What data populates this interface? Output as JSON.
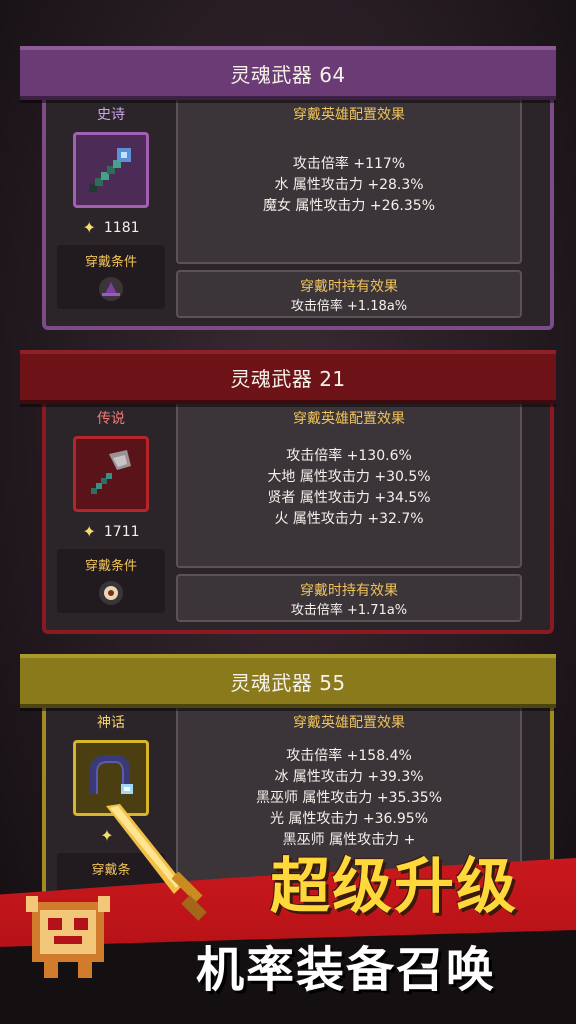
{
  "cards": [
    {
      "title": "灵魂武器 64",
      "rarity": "史诗",
      "power": "1181",
      "requirement_label": "穿戴条件",
      "requirement_icon": "wizard-hat-icon",
      "equip_effects_title": "穿戴英雄配置效果",
      "effects": [
        "攻击倍率 +117%",
        "水 属性攻击力 +28.3%",
        "魔女 属性攻击力 +26.35%"
      ],
      "hold_effects_title": "穿戴时持有效果",
      "hold_effect": "攻击倍率 +1.18a%",
      "weapon_icon": "magic-staff-icon",
      "colors": {
        "header": "#6a3b74",
        "border": "#7e4a88",
        "slot": "#a35fb3",
        "rarity": "#c9a6e8"
      }
    },
    {
      "title": "灵魂武器 21",
      "rarity": "传说",
      "power": "1711",
      "requirement_label": "穿戴条件",
      "requirement_icon": "eye-ring-icon",
      "equip_effects_title": "穿戴英雄配置效果",
      "effects": [
        "攻击倍率 +130.6%",
        "大地 属性攻击力 +30.5%",
        "贤者 属性攻击力 +34.5%",
        "火 属性攻击力 +32.7%"
      ],
      "hold_effects_title": "穿戴时持有效果",
      "hold_effect": "攻击倍率 +1.71a%",
      "weapon_icon": "battle-axe-icon",
      "colors": {
        "header": "#6d1318",
        "border": "#8a1a20",
        "slot": "#b3262c",
        "rarity": "#f07a7a"
      }
    },
    {
      "title": "灵魂武器 55",
      "rarity": "神话",
      "power": "",
      "requirement_label": "穿戴条",
      "effects": [
        "攻击倍率 +158.4%",
        "冰 属性攻击力 +39.3%",
        "黑巫师 属性攻击力 +35.35%",
        "光 属性攻击力 +36.95%",
        "黑巫师 属性攻击力 +"
      ],
      "equip_effects_title": "穿戴英雄配置效果",
      "weapon_icon": "whip-icon",
      "colors": {
        "header": "#8a7a1c",
        "border": "#9f8b22",
        "slot": "#d8b62c",
        "rarity": "#f3d36a"
      }
    }
  ],
  "promo": {
    "line1": "超级升级",
    "line2": "机率装备召唤"
  }
}
